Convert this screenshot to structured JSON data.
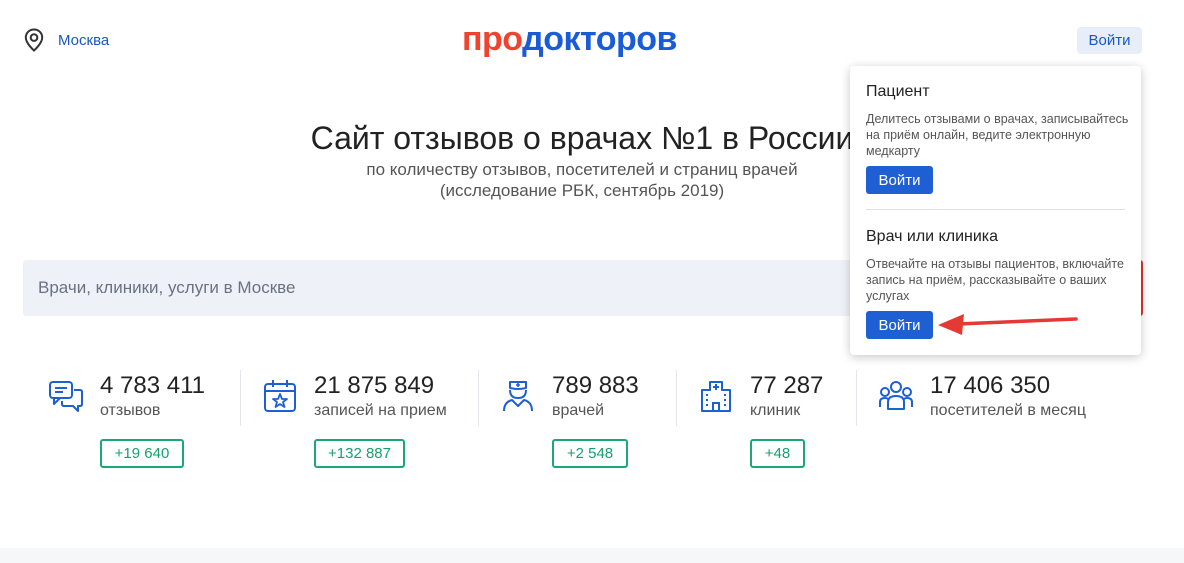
{
  "header": {
    "city": "Москва",
    "logo_pro": "про",
    "logo_doc": "докторов",
    "login_label": "Войти"
  },
  "hero": {
    "title": "Сайт отзывов о врачах №1 в России",
    "subtitle_line1": "по количеству отзывов, посетителей и страниц врачей",
    "subtitle_line2": "(исследование РБК, сентябрь 2019)"
  },
  "search": {
    "placeholder": "Врачи, клиники, услуги в Москве"
  },
  "stats": [
    {
      "icon": "chat-bubbles-icon",
      "number": "4 783 411",
      "label": "отзывов",
      "delta": "+19 640"
    },
    {
      "icon": "calendar-star-icon",
      "number": "21 875 849",
      "label": "записей на прием",
      "delta": "+132 887"
    },
    {
      "icon": "doctor-icon",
      "number": "789 883",
      "label": "врачей",
      "delta": "+2 548"
    },
    {
      "icon": "hospital-icon",
      "number": "77 287",
      "label": "клиник",
      "delta": "+48"
    },
    {
      "icon": "people-group-icon",
      "number": "17 406 350",
      "label": "посетителей в месяц"
    }
  ],
  "dropdown": {
    "patient_title": "Пациент",
    "patient_text": "Делитесь отзывами о врачах, записывайтесь на приём онлайн, ведите электронную медкарту",
    "patient_button": "Войти",
    "doctor_title": "Врач или клиника",
    "doctor_text": "Отвечайте на отзывы пациентов, включайте запись на приём, рассказывайте о ваших услугах",
    "doctor_button": "Войти"
  },
  "colors": {
    "brand_red": "#f0432f",
    "brand_blue": "#1a5bd6",
    "delta_green": "#1ca77a",
    "annotation_arrow": "#e53935"
  }
}
